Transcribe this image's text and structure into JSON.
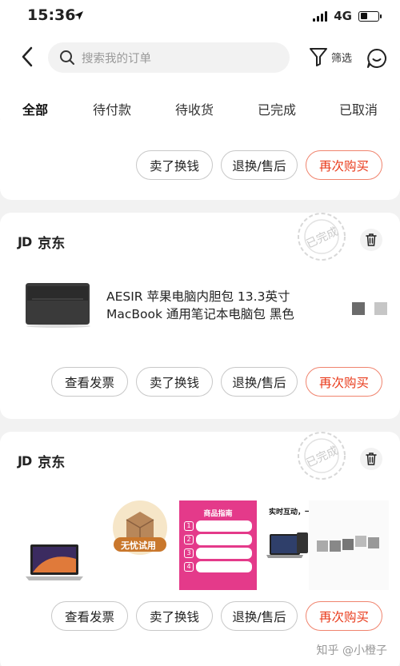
{
  "status": {
    "time": "15:36",
    "network": "4G"
  },
  "search": {
    "placeholder": "搜索我的订单"
  },
  "header": {
    "filter_label": "筛选"
  },
  "tabs": [
    {
      "label": "全部",
      "active": true
    },
    {
      "label": "待付款"
    },
    {
      "label": "待收货"
    },
    {
      "label": "已完成"
    },
    {
      "label": "已取消"
    }
  ],
  "order_top": {
    "buttons": [
      "卖了换钱",
      "退换/售后",
      "再次购买"
    ]
  },
  "order1": {
    "shop_logo": "JD",
    "shop_name": "京东",
    "stamp": "已完成",
    "product_title": "AESIR 苹果电脑内胆包 13.3英寸 MacBook  通用笔记本电脑包 黑色",
    "buttons": [
      "查看发票",
      "卖了换钱",
      "退换/售后",
      "再次购买"
    ]
  },
  "order2": {
    "shop_logo": "JD",
    "shop_name": "京东",
    "stamp": "已完成",
    "badge": "无忧试用",
    "guide_title": "商品指南",
    "promo_text": "实时互动，一入手",
    "buttons": [
      "查看发票",
      "卖了换钱",
      "退换/售后",
      "再次购买"
    ]
  },
  "watermark": "知乎 @小橙子",
  "colors": {
    "accent": "#e93b1c",
    "accent_border": "#f0846e",
    "background": "#f2f2f2"
  }
}
